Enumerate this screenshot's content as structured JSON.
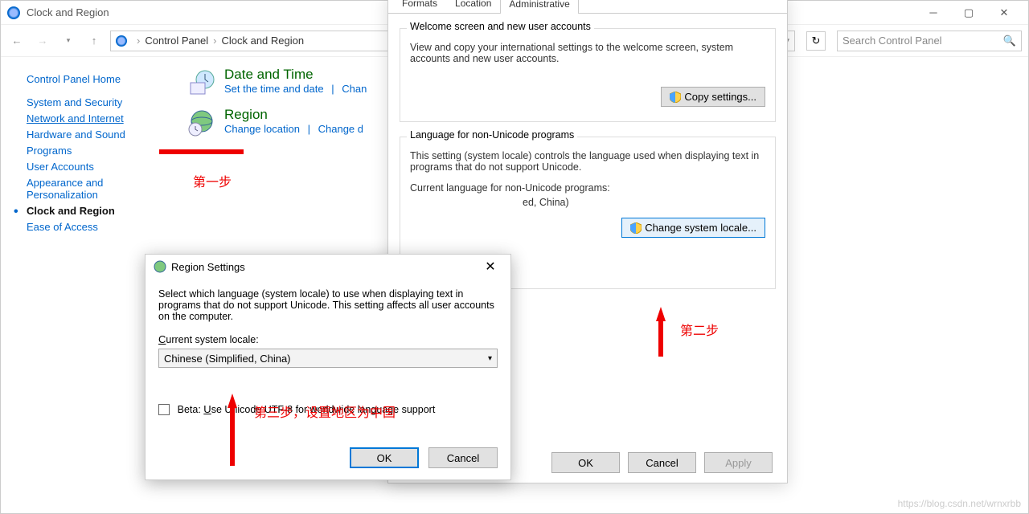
{
  "cp": {
    "title": "Clock and Region",
    "breadcrumb": [
      "Control Panel",
      "Clock and Region"
    ],
    "search_placeholder": "Search Control Panel",
    "home": "Control Panel Home",
    "links": [
      {
        "label": "System and Security",
        "active": false
      },
      {
        "label": "Network and Internet",
        "active": true
      },
      {
        "label": "Hardware and Sound",
        "active": false
      },
      {
        "label": "Programs",
        "active": false
      },
      {
        "label": "User Accounts",
        "active": false
      },
      {
        "label": "Appearance and Personalization",
        "active": false
      },
      {
        "label": "Clock and Region",
        "active": false,
        "bold": true
      },
      {
        "label": "Ease of Access",
        "active": false
      }
    ],
    "items": {
      "datetime": {
        "head": "Date and Time",
        "a": "Set the time and date",
        "b": "Chan"
      },
      "region": {
        "head": "Region",
        "a": "Change location",
        "b": "Change d"
      }
    }
  },
  "rg": {
    "tabs": [
      "Formats",
      "Location",
      "Administrative"
    ],
    "active_tab": 2,
    "g1": {
      "legend": "Welcome screen and new user accounts",
      "text": "View and copy your international settings to the welcome screen, system accounts and new user accounts.",
      "btn": "Copy settings..."
    },
    "g2": {
      "legend": "Language for non-Unicode programs",
      "text": "This setting (system locale) controls the language used when displaying text in programs that do not support Unicode.",
      "cur_label": "Current language for non-Unicode programs:",
      "cur_value": "ed, China)",
      "btn": "Change system locale..."
    },
    "ok": "OK",
    "cancel": "Cancel",
    "apply": "Apply"
  },
  "rs": {
    "title": "Region Settings",
    "text": "Select which language (system locale) to use when displaying text in programs that do not support Unicode. This setting affects all user accounts on the computer.",
    "label": "Current system locale:",
    "value": "Chinese (Simplified, China)",
    "beta": "Beta: Use Unicode UTF-8 for worldwide language support",
    "ok": "OK",
    "cancel": "Cancel"
  },
  "anno": {
    "step1": "第一步",
    "step2": "第二步",
    "step3": "第三步，设置地区为中国",
    "watermark": "https://blog.csdn.net/wrnxrbb"
  }
}
